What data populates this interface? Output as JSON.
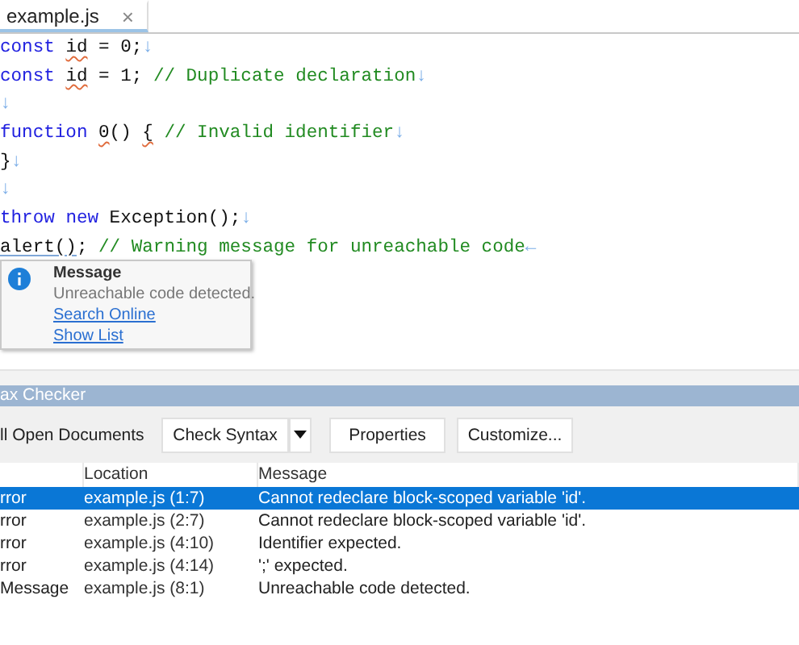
{
  "tab": {
    "label": "example.js",
    "close": "×",
    "selected": true
  },
  "code_lines": [
    {
      "segments": [
        {
          "text": "const ",
          "kind": "keyword"
        },
        {
          "text": "id",
          "kind": "plain",
          "error_squiggle": true
        },
        {
          "text": " = 0;",
          "kind": "plain"
        }
      ],
      "end": "↓"
    },
    {
      "segments": [
        {
          "text": "const ",
          "kind": "keyword"
        },
        {
          "text": "id",
          "kind": "plain",
          "error_squiggle": true
        },
        {
          "text": " = 1; ",
          "kind": "plain"
        },
        {
          "text": "// Duplicate declaration",
          "kind": "comment"
        }
      ],
      "end": "↓"
    },
    {
      "end": "↓"
    },
    {
      "segments": [
        {
          "text": "function ",
          "kind": "keyword"
        },
        {
          "text": "0",
          "kind": "plain",
          "error_squiggle": true
        },
        {
          "text": "() ",
          "kind": "plain"
        },
        {
          "text": "{",
          "kind": "plain",
          "error_squiggle": true
        },
        {
          "text": " // Invalid identifier",
          "kind": "comment"
        }
      ],
      "end": "↓"
    },
    {
      "segments": [
        {
          "text": "}",
          "kind": "plain"
        }
      ],
      "end": "↓"
    },
    {
      "end": "↓"
    },
    {
      "segments": [
        {
          "text": "throw ",
          "kind": "keyword"
        },
        {
          "text": "new",
          "kind": "keyword"
        },
        {
          "text": " Exception();",
          "kind": "plain"
        }
      ],
      "end": "↓"
    },
    {
      "segments": [
        {
          "text": "alert()",
          "kind": "plain",
          "message_underline": true
        },
        {
          "text": "; ",
          "kind": "plain"
        },
        {
          "text": "// Warning message for unreachable code",
          "kind": "comment"
        }
      ],
      "end": "←"
    }
  ],
  "tooltip": {
    "title": "Message",
    "text": "Unreachable code detected.",
    "links": [
      "Search Online",
      "Show List"
    ]
  },
  "panel": {
    "title": "ax Checker",
    "scope": "ll Open Documents",
    "buttons": [
      {
        "label": "Check Syntax",
        "dropdown": true
      },
      {
        "label": "Properties",
        "dropdown": false
      },
      {
        "label": "Customize...",
        "dropdown": false
      }
    ],
    "table": {
      "columns": [
        "Location",
        "Message"
      ],
      "rows": [
        {
          "column_1": "rror",
          "location": "example.js (1:7)",
          "message": "Cannot redeclare block-scoped variable 'id'.",
          "selected": true
        },
        {
          "column_1": "rror",
          "location": "example.js (2:7)",
          "message": "Cannot redeclare block-scoped variable 'id'.",
          "selected": false
        },
        {
          "column_1": "rror",
          "location": "example.js (4:10)",
          "message": "Identifier expected.",
          "selected": false
        },
        {
          "column_1": "rror",
          "location": "example.js (4:14)",
          "message": "';' expected.",
          "selected": false
        },
        {
          "column_1": "Message",
          "location": "example.js (8:1)",
          "message": "Unreachable code detected.",
          "selected": false
        }
      ]
    }
  }
}
